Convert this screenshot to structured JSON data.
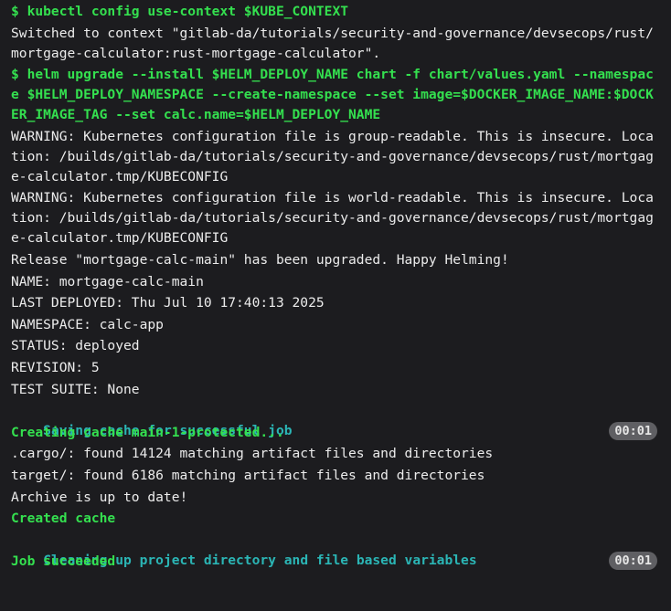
{
  "terminal": {
    "lines": [
      {
        "type": "cmd",
        "text": "$ kubectl config use-context $KUBE_CONTEXT"
      },
      {
        "type": "plain",
        "text": "Switched to context \"gitlab-da/tutorials/security-and-governance/devsecops/rust/mortgage-calculator:rust-mortgage-calculator\"."
      },
      {
        "type": "cmd",
        "text": "$ helm upgrade --install $HELM_DEPLOY_NAME chart -f chart/values.yaml --namespace $HELM_DEPLOY_NAMESPACE --create-namespace --set image=$DOCKER_IMAGE_NAME:$DOCKER_IMAGE_TAG --set calc.name=$HELM_DEPLOY_NAME"
      },
      {
        "type": "plain",
        "text": "WARNING: Kubernetes configuration file is group-readable. This is insecure. Location: /builds/gitlab-da/tutorials/security-and-governance/devsecops/rust/mortgage-calculator.tmp/KUBECONFIG"
      },
      {
        "type": "plain",
        "text": "WARNING: Kubernetes configuration file is world-readable. This is insecure. Location: /builds/gitlab-da/tutorials/security-and-governance/devsecops/rust/mortgage-calculator.tmp/KUBECONFIG"
      },
      {
        "type": "plain",
        "text": "Release \"mortgage-calc-main\" has been upgraded. Happy Helming!"
      },
      {
        "type": "plain",
        "text": "NAME: mortgage-calc-main"
      },
      {
        "type": "plain",
        "text": "LAST DEPLOYED: Thu Jul 10 17:40:13 2025"
      },
      {
        "type": "plain",
        "text": "NAMESPACE: calc-app"
      },
      {
        "type": "plain",
        "text": "STATUS: deployed"
      },
      {
        "type": "plain",
        "text": "REVISION: 5"
      },
      {
        "type": "plain",
        "text": "TEST SUITE: None"
      },
      {
        "type": "section",
        "text": "Saving cache for successful job",
        "duration": "00:01"
      },
      {
        "type": "note",
        "text": "Creating cache main-1-protected..."
      },
      {
        "type": "plain",
        "text": ".cargo/: found 14124 matching artifact files and directories"
      },
      {
        "type": "plain",
        "text": "target/: found 6186 matching artifact files and directories"
      },
      {
        "type": "plain",
        "text": "Archive is up to date!"
      },
      {
        "type": "note",
        "text": "Created cache"
      },
      {
        "type": "section",
        "text": "Cleaning up project directory and file based variables",
        "duration": "00:01"
      },
      {
        "type": "note",
        "text": "Job succeeded"
      }
    ]
  },
  "colors": {
    "background": "#1c1c1f",
    "command": "#34e04f",
    "section_header": "#2bb5b5",
    "plain_text": "#ececec",
    "duration_badge": "#5f5f63"
  }
}
